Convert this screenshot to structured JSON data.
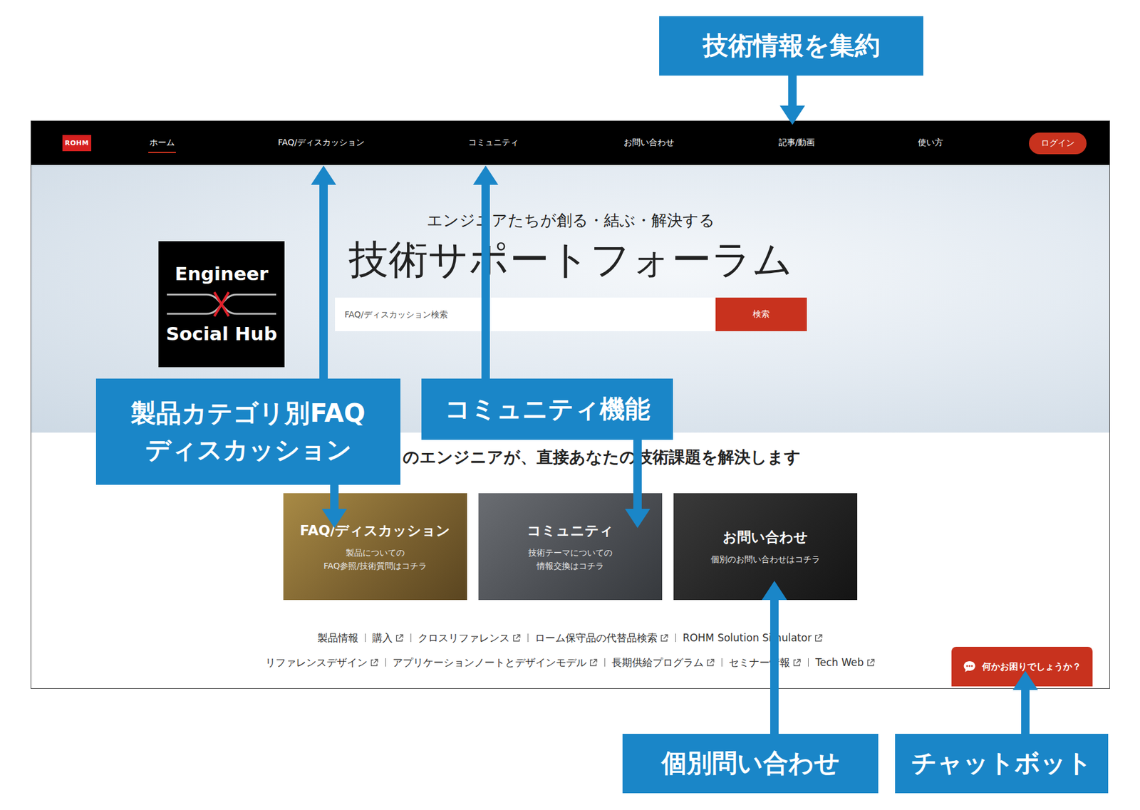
{
  "nav": {
    "logo": "ROHM",
    "items": [
      {
        "label": "ホーム",
        "selected": true
      },
      {
        "label": "FAQ/ディスカッション",
        "selected": false
      },
      {
        "label": "コミュニティ",
        "selected": false
      },
      {
        "label": "お問い合わせ",
        "selected": false
      },
      {
        "label": "記事/動画",
        "selected": false
      },
      {
        "label": "使い方",
        "selected": false
      }
    ],
    "login": "ログイン"
  },
  "hero": {
    "badge": {
      "top": "Engineer",
      "bottom": "Social Hub"
    },
    "subtitle": "エンジニアたちが創る・結ぶ・解決する",
    "title": "技術サポートフォーラム",
    "search": {
      "placeholder": "FAQ/ディスカッション検索",
      "button": "検索"
    }
  },
  "tagline": "のエンジニアが、直接あなたの技術課題を解決します",
  "cards": [
    {
      "title": "FAQ/ディスカッション",
      "lines": [
        "製品についての",
        "FAQ参照/技術質問はコチラ"
      ]
    },
    {
      "title": "コミュニティ",
      "lines": [
        "技術テーマについての",
        "情報交換はコチラ"
      ]
    },
    {
      "title": "お問い合わせ",
      "lines": [
        "個別のお問い合わせはコチラ"
      ]
    }
  ],
  "links": [
    [
      {
        "label": "製品情報",
        "external": false
      },
      {
        "label": "購入",
        "external": true
      },
      {
        "label": "クロスリファレンス",
        "external": true
      },
      {
        "label": "ローム保守品の代替品検索",
        "external": true
      },
      {
        "label": "ROHM Solution Simulator",
        "external": true
      }
    ],
    [
      {
        "label": "リファレンスデザイン",
        "external": true
      },
      {
        "label": "アプリケーションノートとデザインモデル",
        "external": true
      },
      {
        "label": "長期供給プログラム",
        "external": true
      },
      {
        "label": "セミナー情報",
        "external": true
      },
      {
        "label": "Tech Web",
        "external": true
      }
    ]
  ],
  "chat_button": "何かお困りでしょうか？",
  "callouts": [
    {
      "lines": [
        "技術情報を集約"
      ]
    },
    {
      "lines": [
        "製品カテゴリ別FAQ",
        "ディスカッション"
      ]
    },
    {
      "lines": [
        "コミュニティ機能"
      ]
    },
    {
      "lines": [
        "個別問い合わせ"
      ]
    },
    {
      "lines": [
        "チャットボット"
      ]
    }
  ]
}
